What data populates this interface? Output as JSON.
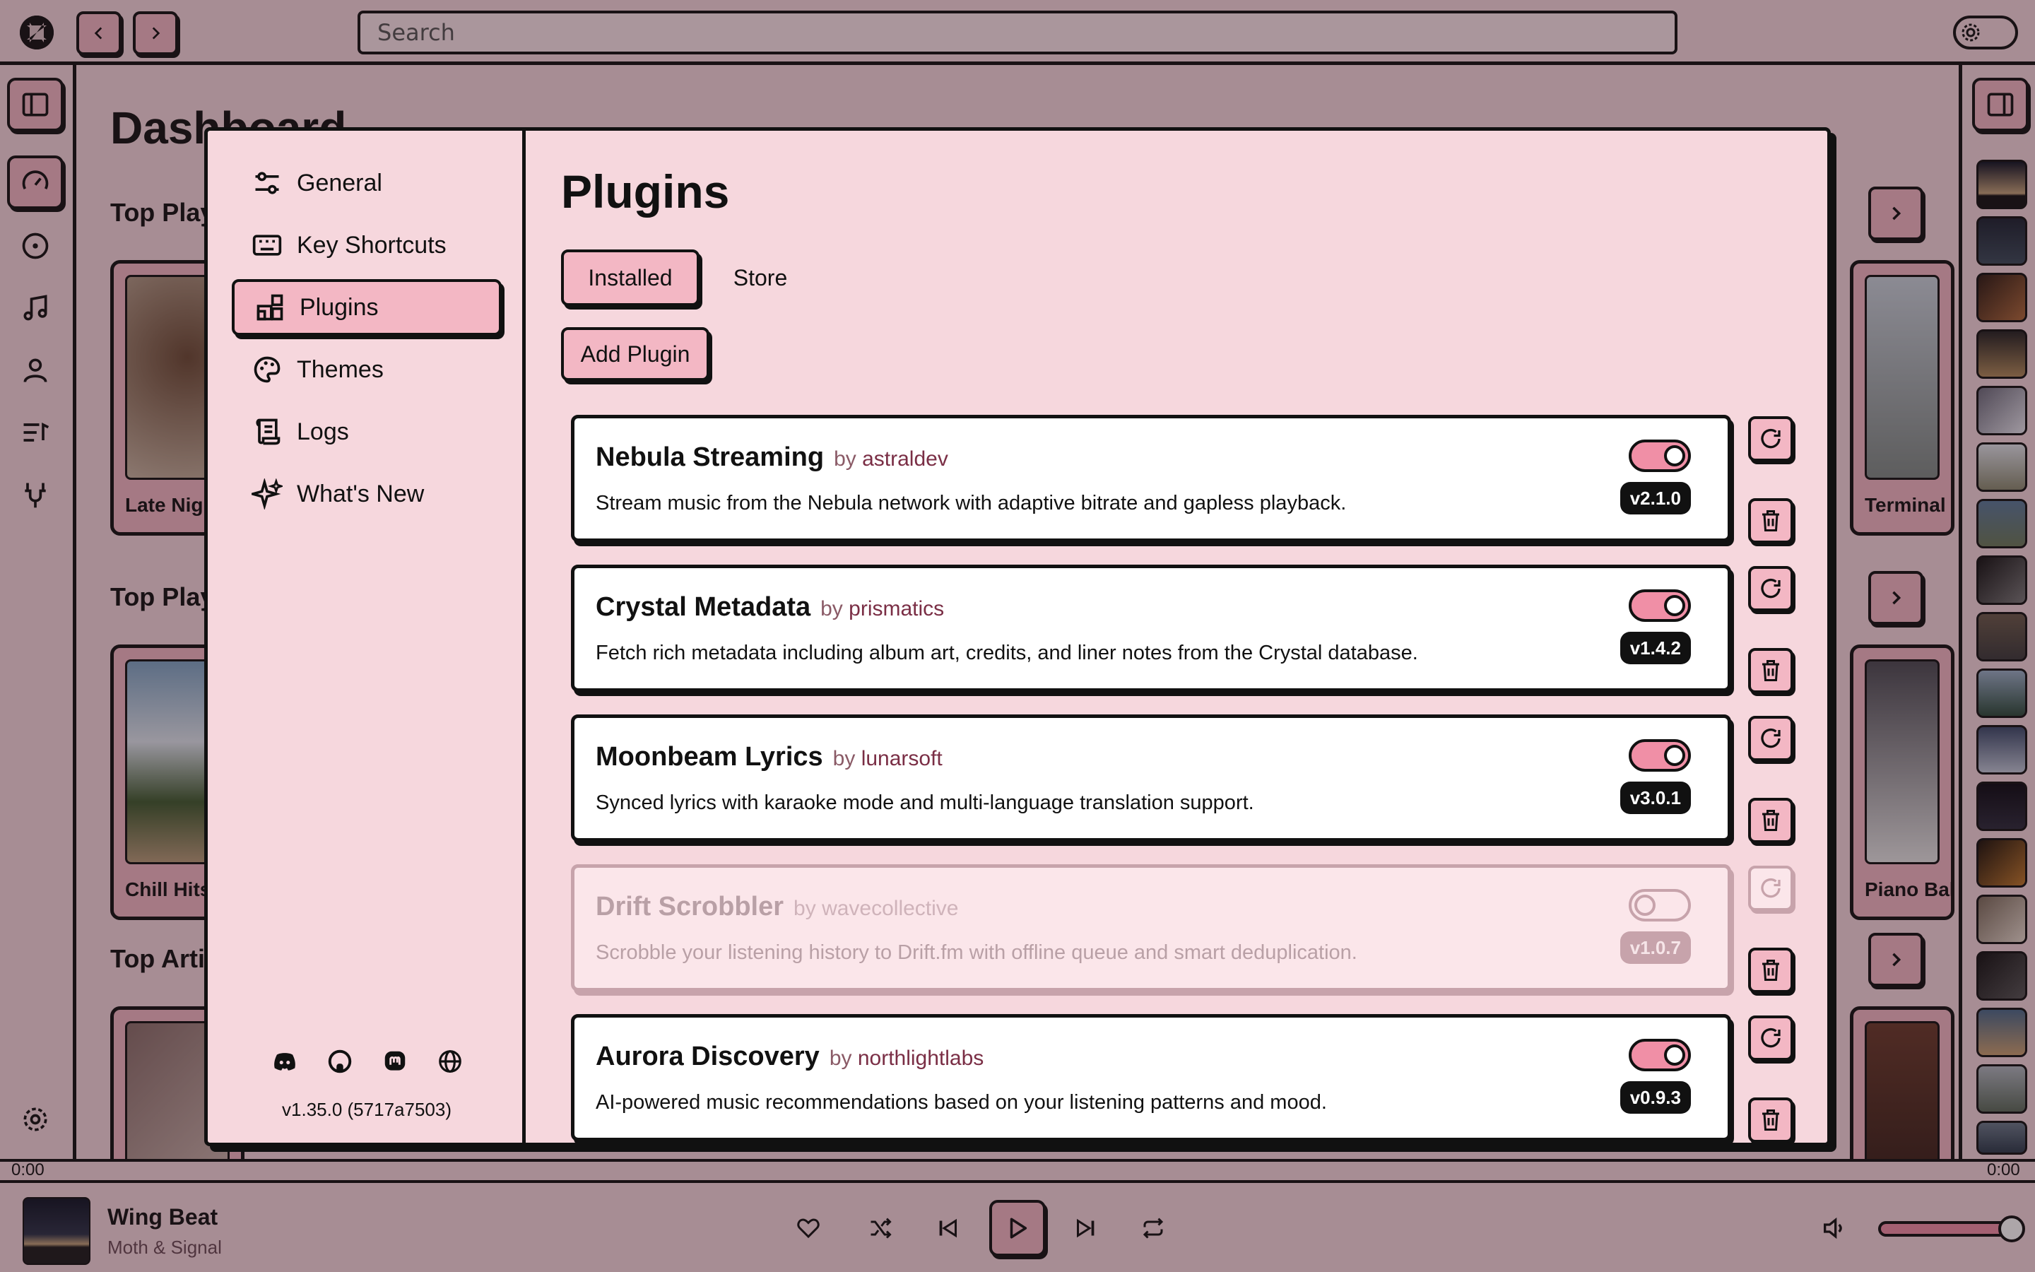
{
  "topbar": {
    "search_placeholder": "Search"
  },
  "dashboard": {
    "title": "Dashboard",
    "sections": [
      "Top Playlists",
      "Top Playlists",
      "Top Artists"
    ],
    "cards": [
      "Late Night",
      "Chill Hits",
      "Terminal",
      "Piano Ballads"
    ]
  },
  "modal": {
    "nav": [
      {
        "label": "General",
        "icon": "sliders-icon"
      },
      {
        "label": "Key Shortcuts",
        "icon": "keyboard-icon"
      },
      {
        "label": "Plugins",
        "icon": "plugins-icon",
        "active": true
      },
      {
        "label": "Themes",
        "icon": "palette-icon"
      },
      {
        "label": "Logs",
        "icon": "scroll-icon"
      },
      {
        "label": "What's New",
        "icon": "sparkles-icon"
      }
    ],
    "version": "v1.35.0 (5717a7503)",
    "title": "Plugins",
    "tabs": [
      {
        "label": "Installed",
        "active": true
      },
      {
        "label": "Store",
        "active": false
      }
    ],
    "add_plugin": "Add Plugin",
    "plugins": [
      {
        "name": "Nebula Streaming",
        "by": "by",
        "author": "astraldev",
        "desc": "Stream music from the Nebula network with adaptive bitrate and gapless playback.",
        "version": "v2.1.0",
        "enabled": true
      },
      {
        "name": "Crystal Metadata",
        "by": "by",
        "author": "prismatics",
        "desc": "Fetch rich metadata including album art, credits, and liner notes from the Crystal database.",
        "version": "v1.4.2",
        "enabled": true
      },
      {
        "name": "Moonbeam Lyrics",
        "by": "by",
        "author": "lunarsoft",
        "desc": "Synced lyrics with karaoke mode and multi-language translation support.",
        "version": "v3.0.1",
        "enabled": true
      },
      {
        "name": "Drift Scrobbler",
        "by": "by",
        "author": "wavecollective",
        "desc": "Scrobble your listening history to Drift.fm with offline queue and smart deduplication.",
        "version": "v1.0.7",
        "enabled": false
      },
      {
        "name": "Aurora Discovery",
        "by": "by",
        "author": "northlightlabs",
        "desc": "AI-powered music recommendations based on your listening patterns and mood.",
        "version": "v0.9.3",
        "enabled": true
      }
    ]
  },
  "player": {
    "time_elapsed": "0:00",
    "time_total": "0:00",
    "track_title": "Wing Beat",
    "track_artist": "Moth & Signal",
    "volume": 1.0,
    "progress": 0
  },
  "colors": {
    "accent": "#f3b7c4",
    "toggle_on": "#f08fa6",
    "background": "#f6d7dd",
    "border": "#111111"
  }
}
